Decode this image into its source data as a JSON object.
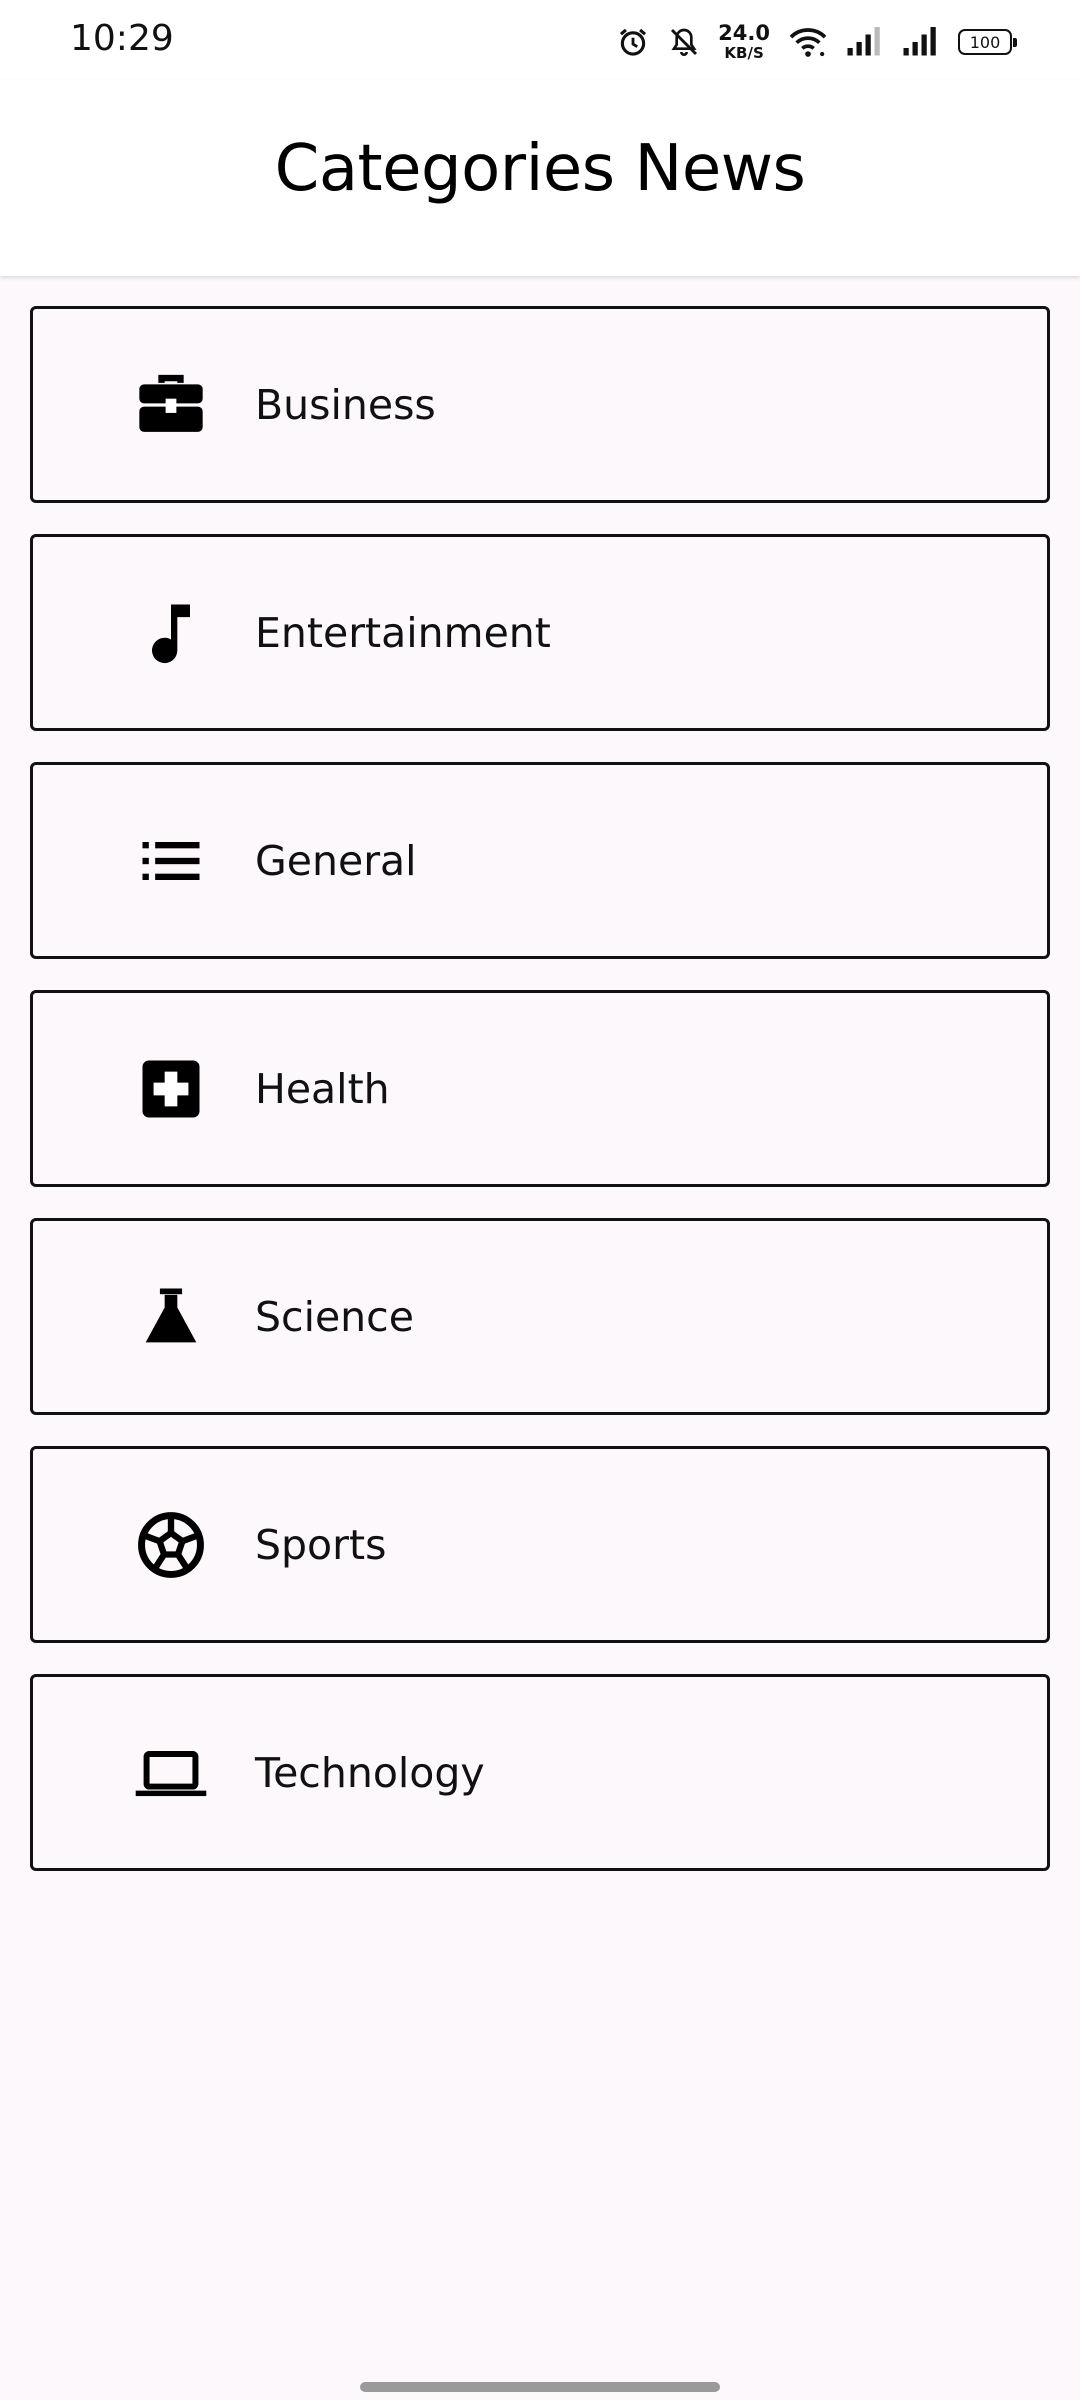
{
  "status_bar": {
    "time": "10:29",
    "net_speed_value": "24.0",
    "net_speed_unit": "KB/S",
    "battery": "100"
  },
  "app_bar": {
    "title": "Categories News"
  },
  "categories": [
    {
      "label": "Business",
      "icon": "briefcase-icon"
    },
    {
      "label": "Entertainment",
      "icon": "music-note-icon"
    },
    {
      "label": "General",
      "icon": "list-icon"
    },
    {
      "label": "Health",
      "icon": "medical-kit-icon"
    },
    {
      "label": "Science",
      "icon": "flask-icon"
    },
    {
      "label": "Sports",
      "icon": "soccer-ball-icon"
    },
    {
      "label": "Technology",
      "icon": "laptop-icon"
    }
  ],
  "colors": {
    "background": "#fdf8fc",
    "card_border": "#111111",
    "app_bar": "#ffffff"
  }
}
